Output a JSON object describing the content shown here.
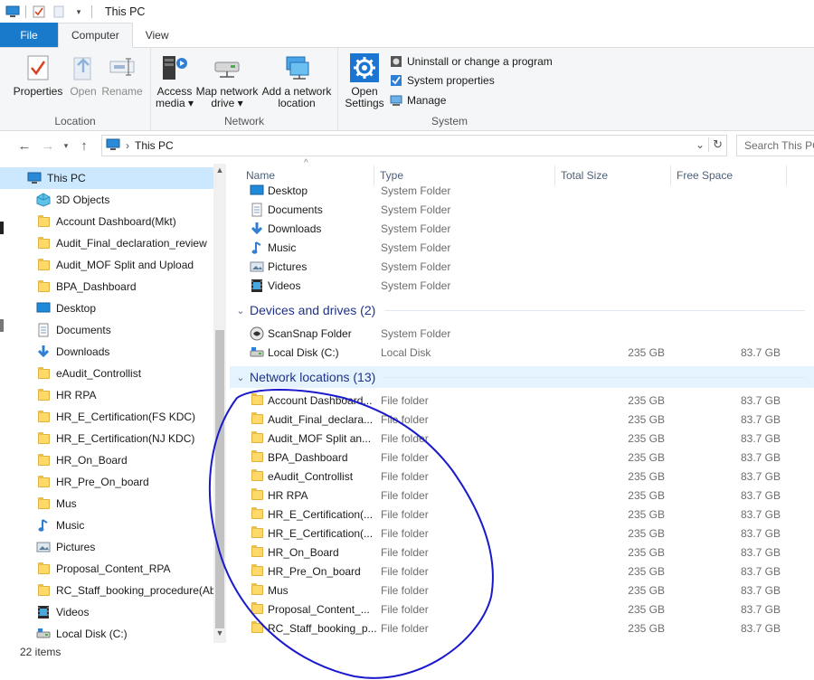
{
  "window": {
    "title": "This PC"
  },
  "tabs": [
    {
      "label": "File"
    },
    {
      "label": "Computer"
    },
    {
      "label": "View"
    }
  ],
  "ribbon": {
    "location_group": "Location",
    "network_group": "Network",
    "system_group": "System",
    "properties": "Properties",
    "open": "Open",
    "rename": "Rename",
    "access_media": "Access media",
    "map_network_drive": "Map network drive",
    "add_network_location": "Add a network location",
    "open_settings": "Open Settings",
    "uninstall": "Uninstall or change a program",
    "system_properties": "System properties",
    "manage": "Manage"
  },
  "address": {
    "path": "This PC",
    "search_placeholder": "Search This PC"
  },
  "nav": {
    "items": [
      {
        "label": "This PC",
        "icon": "pc-icon"
      },
      {
        "label": "3D Objects",
        "icon": "3d-objects-icon"
      },
      {
        "label": "Account Dashboard(Mkt)",
        "icon": "folder-icon"
      },
      {
        "label": "Audit_Final_declaration_review",
        "icon": "folder-icon"
      },
      {
        "label": "Audit_MOF Split and Upload",
        "icon": "folder-icon"
      },
      {
        "label": "BPA_Dashboard",
        "icon": "folder-icon"
      },
      {
        "label": "Desktop",
        "icon": "desktop-icon"
      },
      {
        "label": "Documents",
        "icon": "documents-icon"
      },
      {
        "label": "Downloads",
        "icon": "downloads-icon"
      },
      {
        "label": "eAudit_Controllist",
        "icon": "folder-icon"
      },
      {
        "label": "HR RPA",
        "icon": "folder-icon"
      },
      {
        "label": "HR_E_Certification(FS KDC)",
        "icon": "folder-icon"
      },
      {
        "label": "HR_E_Certification(NJ KDC)",
        "icon": "folder-icon"
      },
      {
        "label": "HR_On_Board",
        "icon": "folder-icon"
      },
      {
        "label": "HR_Pre_On_board",
        "icon": "folder-icon"
      },
      {
        "label": "Mus",
        "icon": "folder-icon"
      },
      {
        "label": "Music",
        "icon": "music-icon"
      },
      {
        "label": "Pictures",
        "icon": "pictures-icon"
      },
      {
        "label": "Proposal_Content_RPA",
        "icon": "folder-icon"
      },
      {
        "label": "RC_Staff_booking_procedure(Abl",
        "icon": "folder-icon"
      },
      {
        "label": "Videos",
        "icon": "videos-icon"
      },
      {
        "label": "Local Disk (C:)",
        "icon": "disk-icon"
      }
    ]
  },
  "columns": {
    "name": "Name",
    "type": "Type",
    "total": "Total Size",
    "free": "Free Space"
  },
  "folders": [
    {
      "name": "Desktop",
      "type": "System Folder",
      "icon": "desktop-icon"
    },
    {
      "name": "Documents",
      "type": "System Folder",
      "icon": "documents-icon"
    },
    {
      "name": "Downloads",
      "type": "System Folder",
      "icon": "downloads-icon"
    },
    {
      "name": "Music",
      "type": "System Folder",
      "icon": "music-icon"
    },
    {
      "name": "Pictures",
      "type": "System Folder",
      "icon": "pictures-icon"
    },
    {
      "name": "Videos",
      "type": "System Folder",
      "icon": "videos-icon"
    }
  ],
  "devices_group": "Devices and drives (2)",
  "devices": [
    {
      "name": "ScanSnap Folder",
      "type": "System Folder",
      "total": "",
      "free": "",
      "icon": "scansnap-icon"
    },
    {
      "name": "Local Disk (C:)",
      "type": "Local Disk",
      "total": "235 GB",
      "free": "83.7 GB",
      "icon": "disk-icon"
    }
  ],
  "network_group": "Network locations (13)",
  "network": [
    {
      "name": "Account Dashboard...",
      "type": "File folder",
      "total": "235 GB",
      "free": "83.7 GB"
    },
    {
      "name": "Audit_Final_declara...",
      "type": "File folder",
      "total": "235 GB",
      "free": "83.7 GB"
    },
    {
      "name": "Audit_MOF Split an...",
      "type": "File folder",
      "total": "235 GB",
      "free": "83.7 GB"
    },
    {
      "name": "BPA_Dashboard",
      "type": "File folder",
      "total": "235 GB",
      "free": "83.7 GB"
    },
    {
      "name": "eAudit_Controllist",
      "type": "File folder",
      "total": "235 GB",
      "free": "83.7 GB"
    },
    {
      "name": "HR RPA",
      "type": "File folder",
      "total": "235 GB",
      "free": "83.7 GB"
    },
    {
      "name": "HR_E_Certification(...",
      "type": "File folder",
      "total": "235 GB",
      "free": "83.7 GB"
    },
    {
      "name": "HR_E_Certification(...",
      "type": "File folder",
      "total": "235 GB",
      "free": "83.7 GB"
    },
    {
      "name": "HR_On_Board",
      "type": "File folder",
      "total": "235 GB",
      "free": "83.7 GB"
    },
    {
      "name": "HR_Pre_On_board",
      "type": "File folder",
      "total": "235 GB",
      "free": "83.7 GB"
    },
    {
      "name": "Mus",
      "type": "File folder",
      "total": "235 GB",
      "free": "83.7 GB"
    },
    {
      "name": "Proposal_Content_...",
      "type": "File folder",
      "total": "235 GB",
      "free": "83.7 GB"
    },
    {
      "name": "RC_Staff_booking_p...",
      "type": "File folder",
      "total": "235 GB",
      "free": "83.7 GB"
    }
  ],
  "status": {
    "items": "22 items"
  },
  "colors": {
    "file_tab": "#1979ca",
    "selection": "#cce8ff",
    "group_header": "#1e3287",
    "annotation": "#1a1acc"
  }
}
